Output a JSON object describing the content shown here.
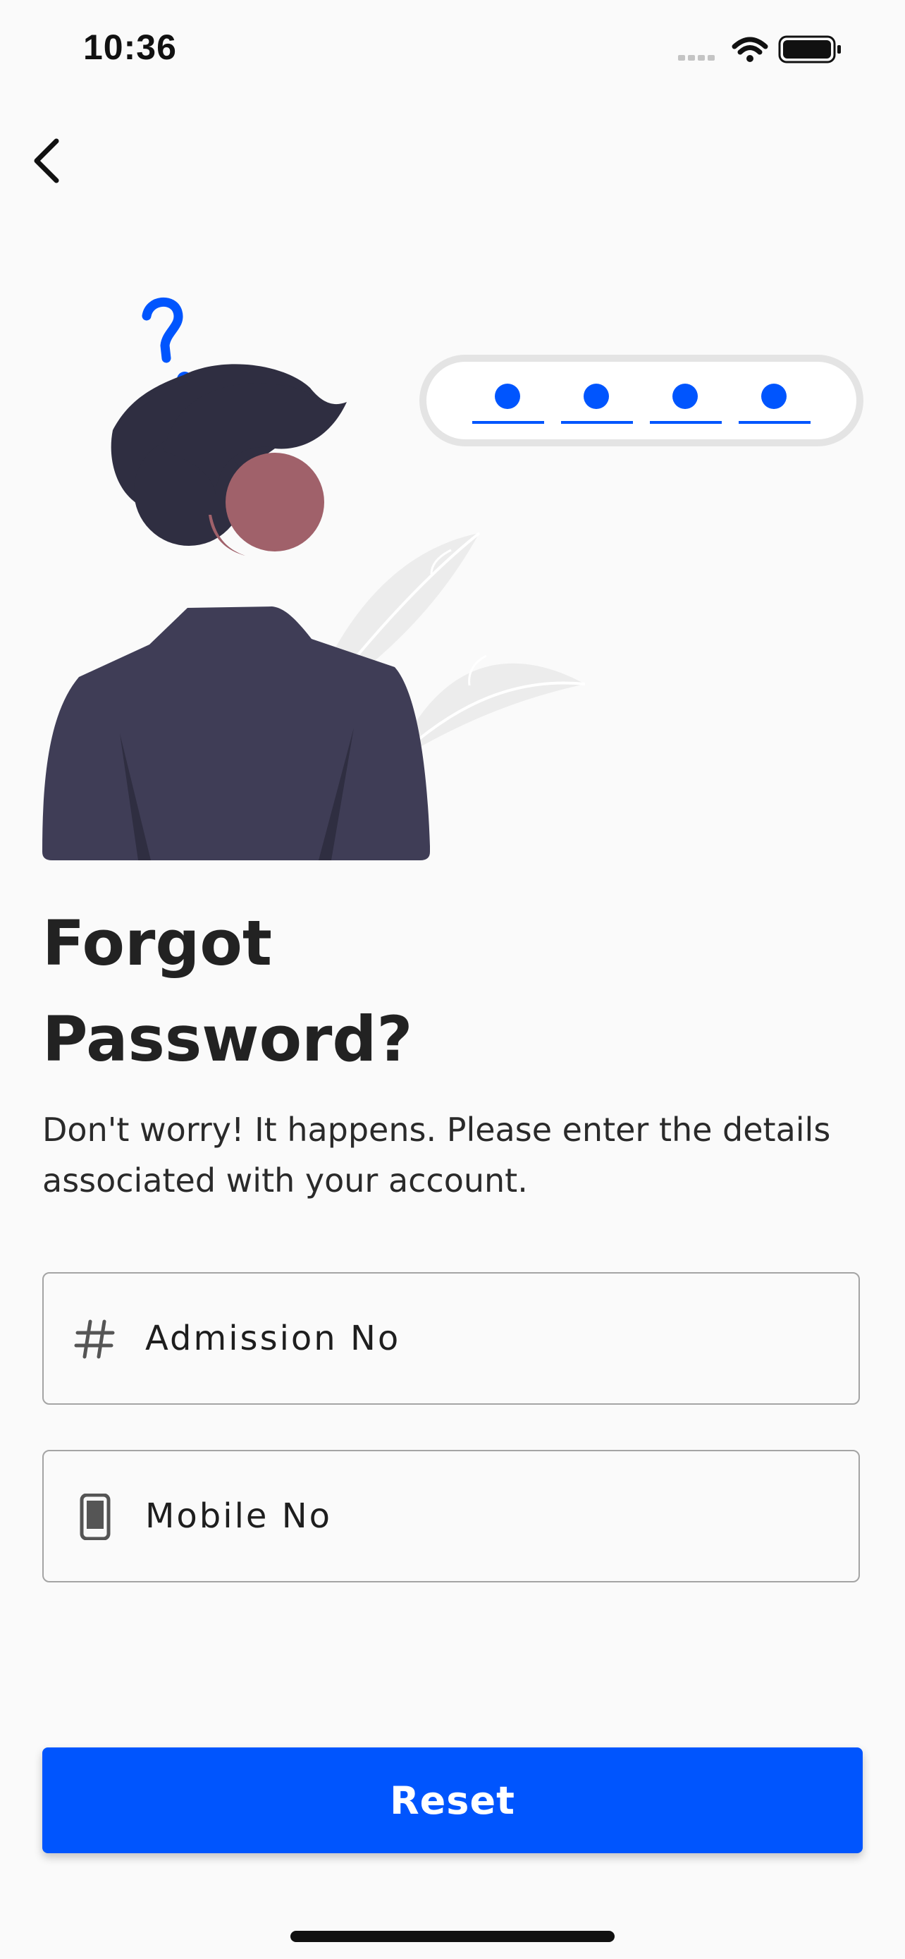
{
  "status_bar": {
    "time": "10:36",
    "icons": [
      "signal-dots-icon",
      "wifi-icon",
      "battery-icon"
    ]
  },
  "nav": {
    "back_icon": "chevron-left-icon"
  },
  "illustration": {
    "code_dots": 4,
    "accent_color": "#0055fe"
  },
  "page": {
    "title_line1": "Forgot",
    "title_line2": "Password?",
    "description": "Don't worry! It happens. Please enter the details associated with your account."
  },
  "form": {
    "admission": {
      "icon": "hash-icon",
      "placeholder": "Admission No",
      "value": ""
    },
    "mobile": {
      "icon": "smartphone-icon",
      "placeholder": "Mobile No",
      "value": ""
    }
  },
  "actions": {
    "reset_label": "Reset",
    "reset_color": "#0055fe"
  }
}
